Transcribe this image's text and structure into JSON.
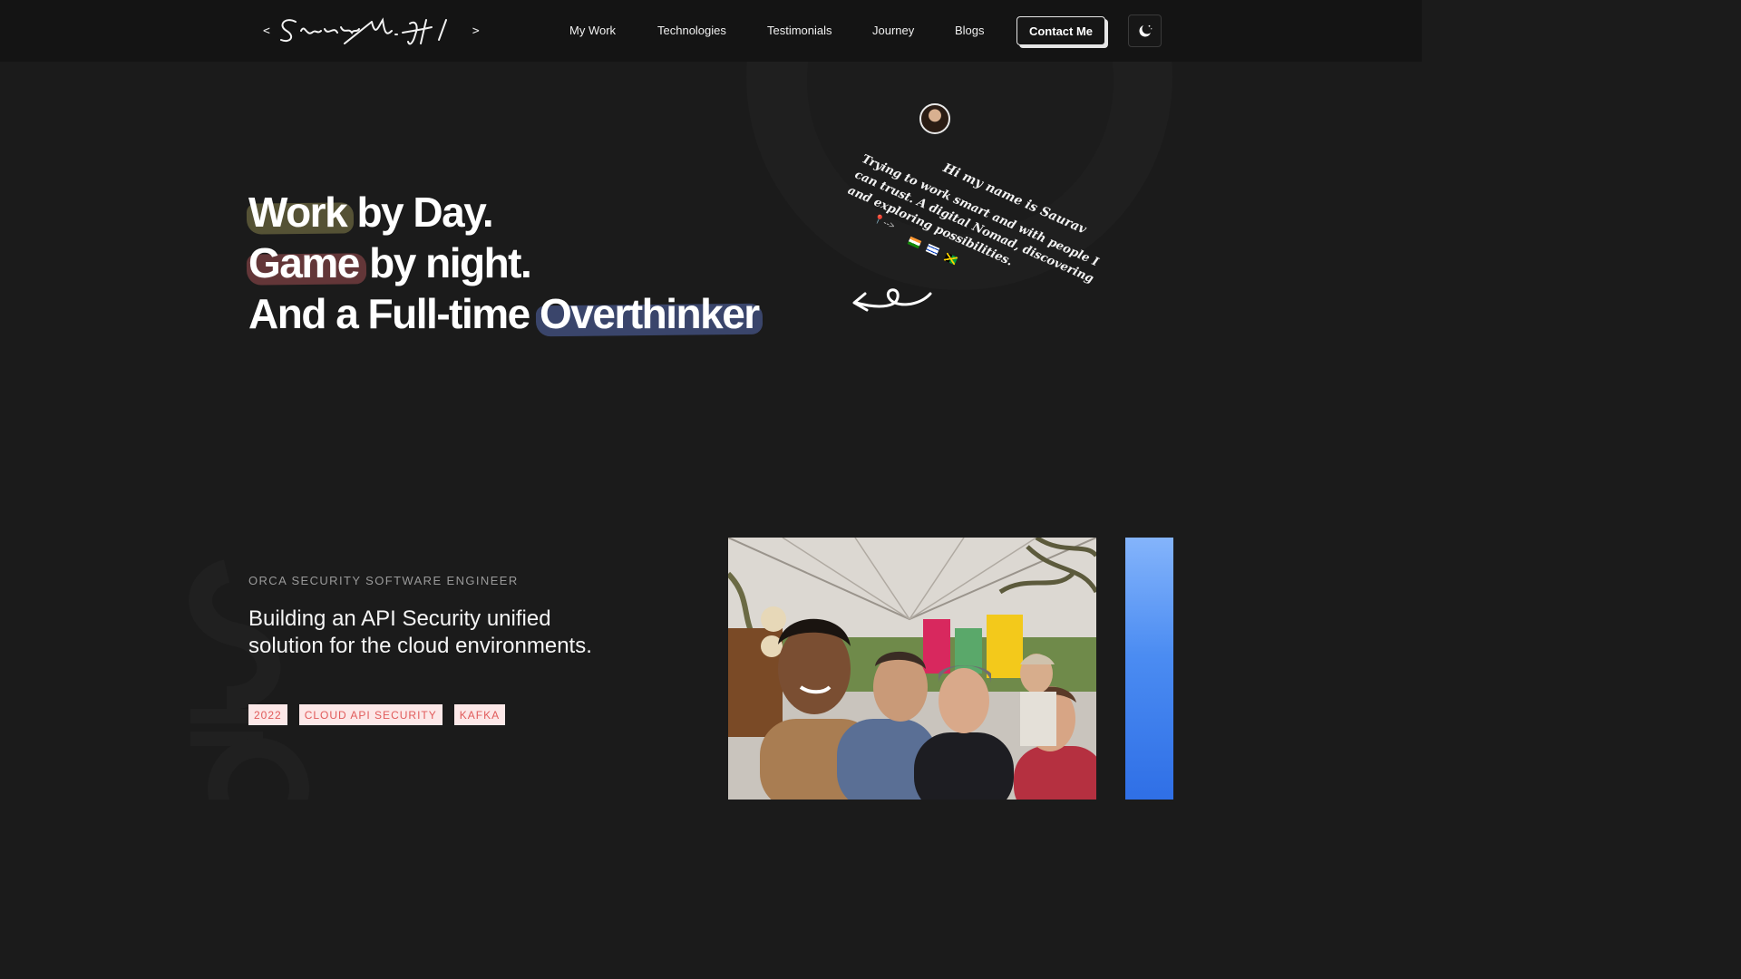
{
  "nav": {
    "logo_open": "<",
    "logo_text": "Saurav M. H /",
    "logo_close": ">",
    "links": [
      {
        "label": "My Work"
      },
      {
        "label": "Technologies"
      },
      {
        "label": "Testimonials"
      },
      {
        "label": "Journey"
      },
      {
        "label": "Blogs"
      }
    ],
    "contact_label": "Contact Me",
    "theme_toggle_icon": "moon-icon"
  },
  "hero": {
    "line1_highlight": "Work",
    "line1_rest": " by Day.",
    "line2_highlight": "Game",
    "line2_rest": " by night.",
    "line3_rest": "And a Full-time ",
    "line3_highlight": "Overthinker",
    "note_greeting": "Hi my name is Saurav",
    "note_bio": "Trying to work smart and with people I can trust. A digital Nomad, discovering and exploring possibilities.",
    "note_pin": "📍-->",
    "flags": [
      "india-flag-icon",
      "israel-flag-icon",
      "jamaica-flag-icon"
    ]
  },
  "work": {
    "eyebrow": "ORCA SECURITY SOFTWARE ENGINEER",
    "title": "Building an API Security unified solution for the cloud environments.",
    "tags": [
      "2022",
      "CLOUD API SECURITY",
      "KAFKA"
    ]
  },
  "colors": {
    "background": "#1b1b1b",
    "navbar": "#141414",
    "highlight_work": "#5f5c3a",
    "highlight_game": "#6b3a3c",
    "highlight_overthinker": "#3e4a74",
    "tag_bg": "#fce8e8",
    "tag_text": "#e15b5b",
    "accent_bar": "#4b8cf2"
  }
}
